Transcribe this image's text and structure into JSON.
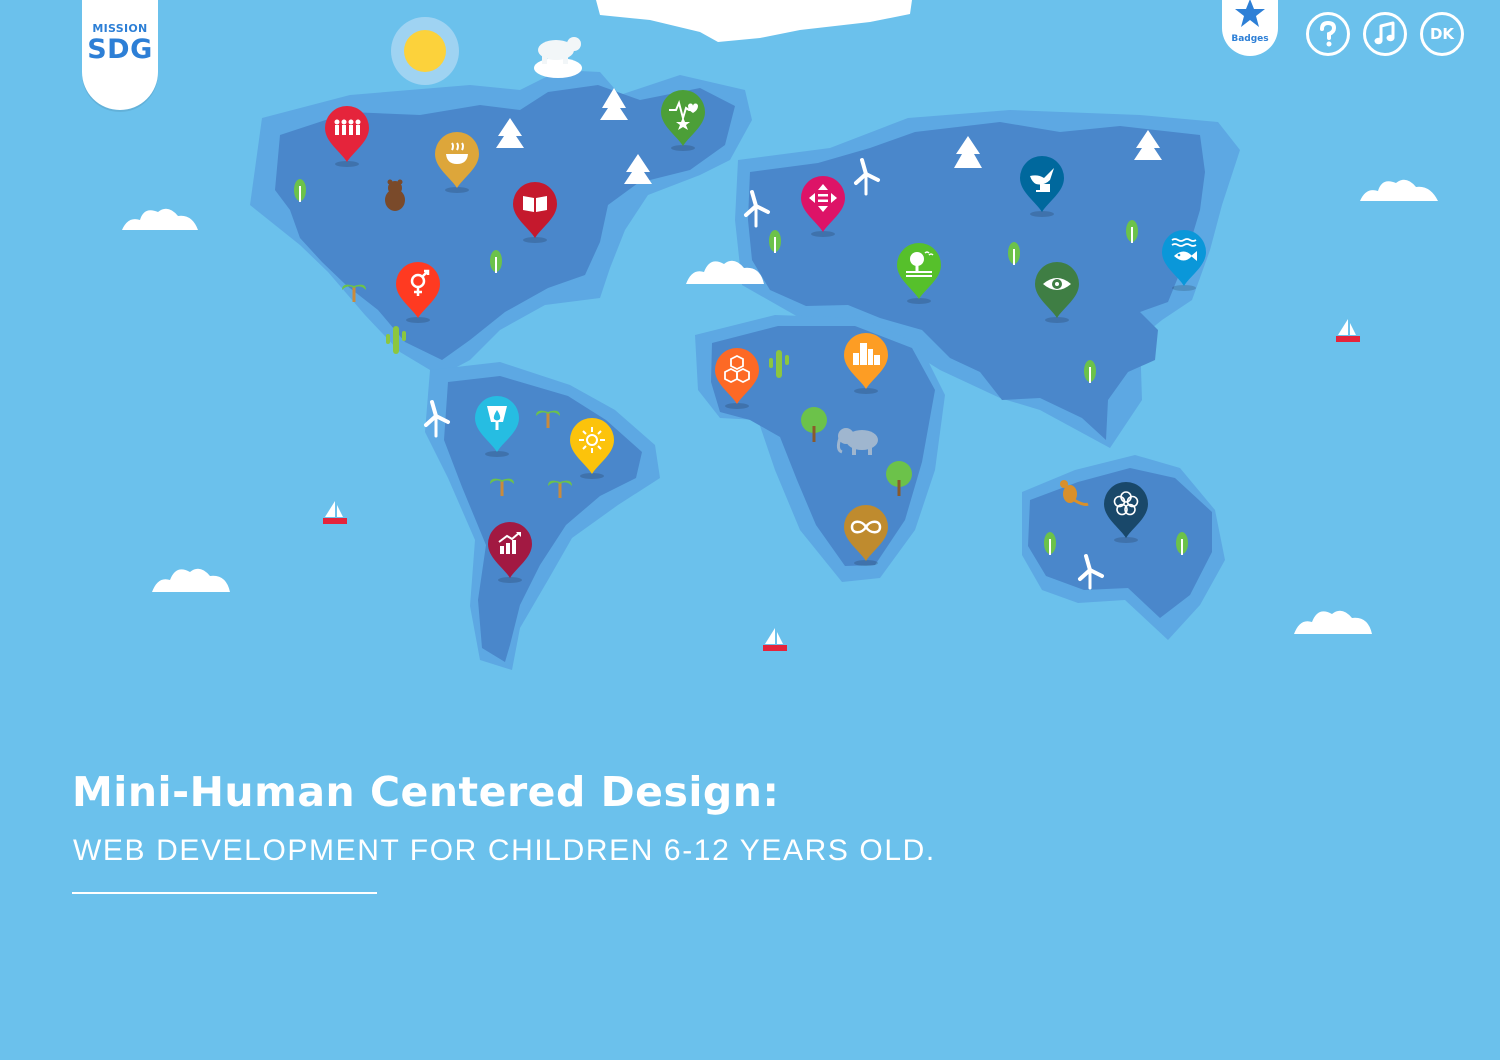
{
  "app": {
    "logo_top": "MISSION",
    "logo_bottom": "SDG"
  },
  "toolbar": {
    "badges_label": "Badges",
    "language_label": "DK"
  },
  "headline": {
    "title": "Mini-Human Centered Design:",
    "subtitle": "WEB DEVELOPMENT FOR CHILDREN 6-12 YEARS OLD."
  },
  "colors": {
    "ocean": "#6bc1ec",
    "land": "#4a87cb",
    "shelf": "#5da8e3",
    "brand": "#2d7fd6"
  },
  "goal_pins": [
    {
      "goal": 1,
      "icon": "family-icon",
      "color": "#e5243b"
    },
    {
      "goal": 2,
      "icon": "food-bowl-icon",
      "color": "#dda63a"
    },
    {
      "goal": 3,
      "icon": "heartbeat-icon",
      "color": "#4c9f38"
    },
    {
      "goal": 4,
      "icon": "book-icon",
      "color": "#c5192d"
    },
    {
      "goal": 5,
      "icon": "gender-icon",
      "color": "#ff3a21"
    },
    {
      "goal": 6,
      "icon": "water-drop-icon",
      "color": "#26bde2"
    },
    {
      "goal": 7,
      "icon": "sun-icon",
      "color": "#fcc30b"
    },
    {
      "goal": 8,
      "icon": "growth-chart-icon",
      "color": "#a21942"
    },
    {
      "goal": 9,
      "icon": "cubes-icon",
      "color": "#fd6925"
    },
    {
      "goal": 10,
      "icon": "equality-icon",
      "color": "#dd1367"
    },
    {
      "goal": 11,
      "icon": "city-icon",
      "color": "#fd9d24"
    },
    {
      "goal": 12,
      "icon": "infinity-icon",
      "color": "#bf8b2e"
    },
    {
      "goal": 13,
      "icon": "eye-globe-icon",
      "color": "#3f7e44"
    },
    {
      "goal": 14,
      "icon": "fish-icon",
      "color": "#0a97d9"
    },
    {
      "goal": 15,
      "icon": "tree-land-icon",
      "color": "#56c02b"
    },
    {
      "goal": 16,
      "icon": "dove-icon",
      "color": "#00689d"
    },
    {
      "goal": 17,
      "icon": "partnership-flower-icon",
      "color": "#19486a"
    }
  ]
}
